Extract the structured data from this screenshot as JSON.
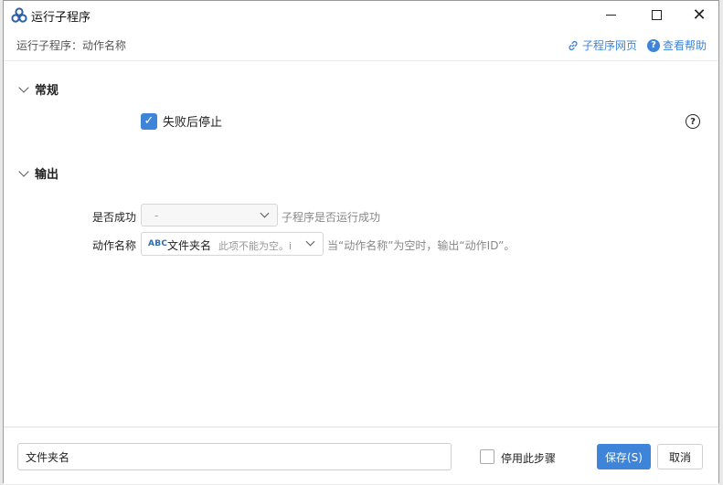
{
  "window": {
    "title": "运行子程序",
    "minimize_icon": "minimize-icon",
    "maximize_icon": "maximize-icon",
    "close_icon": "close-icon"
  },
  "header": {
    "subtitle": "运行子程序：动作名称",
    "page_link": "子程序网页",
    "help_link": "查看帮助"
  },
  "sections": {
    "general": {
      "title": "常规"
    },
    "output": {
      "title": "输出"
    }
  },
  "general": {
    "stop_on_failure_label": "失败后停止",
    "stop_on_failure_checked": true,
    "help_mark": "?"
  },
  "output": {
    "success_label": "是否成功",
    "success_value": "-",
    "success_hint": "子程序是否运行成功",
    "name_label": "动作名称",
    "name_type_badge": "ABC",
    "name_value": "文件夹名",
    "name_placeholder": "此项不能为空。i",
    "name_hint": "当“动作名称”为空时，输出“动作ID”。"
  },
  "footer": {
    "step_name_value": "文件夹名",
    "disable_step_label": "停用此步骤",
    "disable_step_checked": false,
    "save_label": "保存(S)",
    "cancel_label": "取消"
  },
  "colors": {
    "accent": "#3e84d8",
    "hint_text": "#888888"
  }
}
